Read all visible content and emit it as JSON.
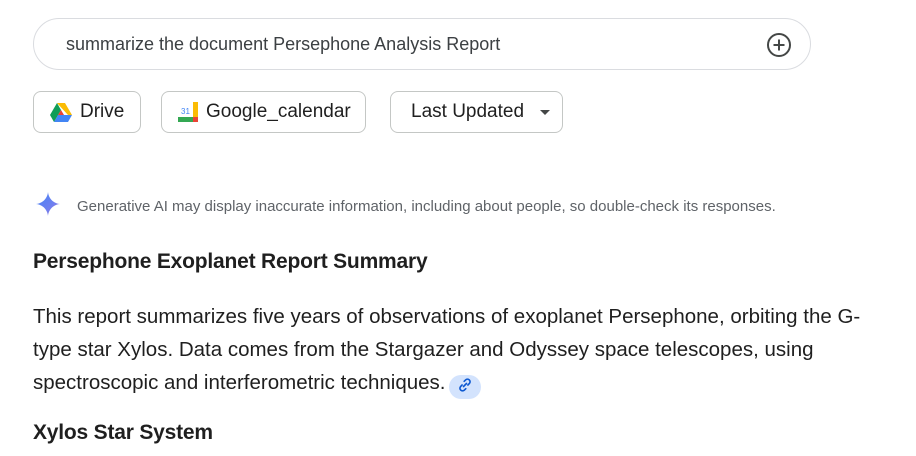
{
  "search": {
    "query": "summarize the document Persephone Analysis Report",
    "add_icon": "plus-circle-icon"
  },
  "filters": {
    "drive_label": "Drive",
    "drive_icon": "google-drive-icon",
    "calendar_label": "Google_calendar",
    "calendar_icon": "google-calendar-icon",
    "calendar_icon_text": "31",
    "sort_label": "Last Updated"
  },
  "disclaimer": {
    "icon": "gemini-sparkle-icon",
    "text": "Generative AI may display inaccurate information, including about people, so double-check its responses."
  },
  "response": {
    "title": "Persephone Exoplanet Report Summary",
    "paragraph": "This report summarizes five years of observations of exoplanet Persephone, orbiting the G-type star Xylos. Data comes from the Stargazer and Odyssey space telescopes, using spectroscopic and interferometric techniques.",
    "source_icon": "link-icon",
    "section_heading": "Xylos Star System"
  },
  "colors": {
    "accent_blue": "#4285f4",
    "link_chip_bg": "#d3e3fd"
  }
}
